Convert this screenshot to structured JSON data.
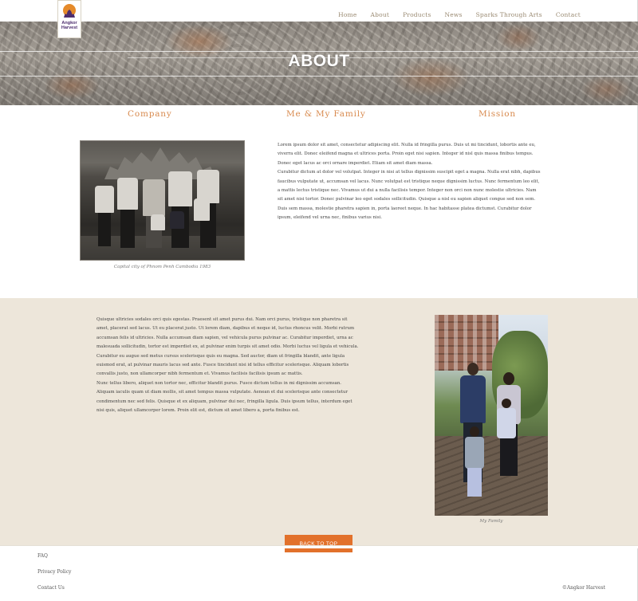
{
  "logo": {
    "brand_line1": "Angkor",
    "brand_line2": "Harvest"
  },
  "nav": {
    "items": [
      "Home",
      "About",
      "Products",
      "News",
      "Sparks Through Arts",
      "Contact"
    ]
  },
  "hero": {
    "title": "ABOUT"
  },
  "tabs": [
    "Company",
    "Me & My Family",
    "Mission"
  ],
  "section1": {
    "photo_caption": "Capital city of Phnom Penh Cambodia 1983",
    "paragraph_a": "Lorem ipsum dolor sit amet, consectetur adipiscing elit. Nulla id fringilla purus. Duis ut mi tincidunt, lobortis ante eu, viverra elit. Donec eleifend magna et ultrices porta. Proin eget nisi sapien. Integer id nisl quis massa finibus tempus. Donec eget lacus ac orci ornare imperdiet. Etiam sit amet diam massa.",
    "paragraph_b": "Curabitur dictum at dolor vel volutpat. Integer in nisi at tellus dignissim suscipit eget a magna. Nulla erat nibh, dapibus faucibus vulputate ut, accumsan vel lacus. Nunc volutpat est tristique neque dignissim luctus. Nunc fermentum leo elit, a mattis lectus tristique nec. Vivamus ut dui a nulla facilisis tempor. Integer non orci non nunc molestie ultricies. Nam sit amet nisi tortor. Donec pulvinar leo eget sodales sollicitudin. Quisque a nisl eu sapien aliquet congue sed non sem. Duis sem massa, molestie pharetra sapien in, porta laoreet neque. In hac habitasse platea dictumst. Curabitur dolor ipsum, eleifend vel urna nec, finibus varius nisi."
  },
  "section2": {
    "paragraph_a": "Quisque ultricies sodales orci quis egestas. Praesent sit amet purus dui. Nam orci purus, tristique non pharetra sit amet, placerat sed lacus. Ut eu placerat justo. Ut lorem diam, dapibus et neque id, luctus rhoncus velit. Morbi rutrum accumsan felis id ultricies. Nulla accumsan diam sapien, vel vehicula purus pulvinar ac. Curabitur imperdiet, urna ac malesuada sollicitudin, tortor est imperdiet ex, at pulvinar enim turpis sit amet odio. Morbi luctus vel ligula et vehicula. Curabitur eu augue sed metus cursus scelerisque quis eu magna. Sed auctor, diam ut fringilla blandit, ante ligula euismod erat, at pulvinar mauris lacus sed ante. Fusce tincidunt nisi id tellus efficitur scelerisque. Aliquam lobortis convallis justo, non ullamcorper nibh fermentum et. Vivamus facilisis facilisis ipsum ac mattis.",
    "paragraph_b": "Nunc tellus libero, aliquet non tortor nec, efficitur blandit purus. Fusce dictum tellus in mi dignissim accumsan. Aliquam iaculis quam ut diam mollis, sit amet tempus massa vulputate. Aenean et dui scelerisque ante consectetur condimentum nec sed felis. Quisque et ex aliquam, pulvinar dui nec, fringilla ligula. Duis ipsum tellus, interdum eget nisi quis, aliquet ullamcorper lorem. Proin elit est, dictum sit amet libero a, porta finibus est.",
    "photo_caption": "My Family"
  },
  "back_to_top": "BACK TO TOP",
  "footer": {
    "links": [
      "FAQ",
      "Privacy Policy",
      "Contact Us"
    ],
    "copyright": "©Angkor Harvest"
  },
  "colors": {
    "accent_orange": "#e2712b",
    "tab_orange": "#d88a4e",
    "band_beige": "#ede6da",
    "nav_text": "#9a8a72",
    "logo_purple": "#4d2d6e"
  }
}
